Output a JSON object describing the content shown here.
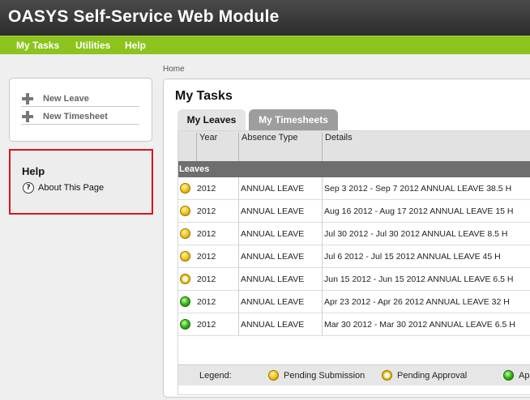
{
  "app": {
    "title": "OASYS Self-Service Web Module"
  },
  "nav": {
    "items": [
      "My Tasks",
      "Utilities",
      "Help"
    ]
  },
  "breadcrumb": "Home",
  "actions": {
    "new_leave": "New Leave",
    "new_timesheet": "New Timesheet"
  },
  "help": {
    "heading": "Help",
    "about": "About This Page",
    "icon_glyph": "?"
  },
  "main": {
    "title": "My Tasks",
    "tabs": [
      {
        "label": "My Leaves",
        "active": true
      },
      {
        "label": "My Timesheets",
        "active": false
      }
    ],
    "columns": [
      "Year",
      "Absence Type",
      "Details"
    ],
    "group_label": "Leaves",
    "rows": [
      {
        "status": "pending-submission",
        "year": "2012",
        "type": "ANNUAL LEAVE",
        "details": "Sep 3 2012 - Sep 7 2012 ANNUAL LEAVE 38.5 H"
      },
      {
        "status": "pending-submission",
        "year": "2012",
        "type": "ANNUAL LEAVE",
        "details": "Aug 16 2012 - Aug 17 2012 ANNUAL LEAVE 15 H"
      },
      {
        "status": "pending-submission",
        "year": "2012",
        "type": "ANNUAL LEAVE",
        "details": "Jul 30 2012 - Jul 30 2012 ANNUAL LEAVE 8.5 H"
      },
      {
        "status": "pending-submission",
        "year": "2012",
        "type": "ANNUAL LEAVE",
        "details": "Jul 6 2012 - Jul 15 2012 ANNUAL LEAVE 45 H"
      },
      {
        "status": "pending-approval",
        "year": "2012",
        "type": "ANNUAL LEAVE",
        "details": "Jun 15 2012 - Jun 15 2012 ANNUAL LEAVE 6.5 H"
      },
      {
        "status": "approved",
        "year": "2012",
        "type": "ANNUAL LEAVE",
        "details": "Apr 23 2012 - Apr 26 2012 ANNUAL LEAVE 32 H"
      },
      {
        "status": "approved",
        "year": "2012",
        "type": "ANNUAL LEAVE",
        "details": "Mar 30 2012 - Mar 30 2012 ANNUAL LEAVE 6.5 H"
      }
    ],
    "legend": {
      "label": "Legend:",
      "pending_submission": "Pending Submission",
      "pending_approval": "Pending Approval",
      "approved_partial": "Ap"
    }
  },
  "colors": {
    "header_bg": "#333333",
    "nav_bg": "#8cc31d",
    "highlight_border": "#d9141c",
    "group_bg": "#6e6e6e"
  }
}
